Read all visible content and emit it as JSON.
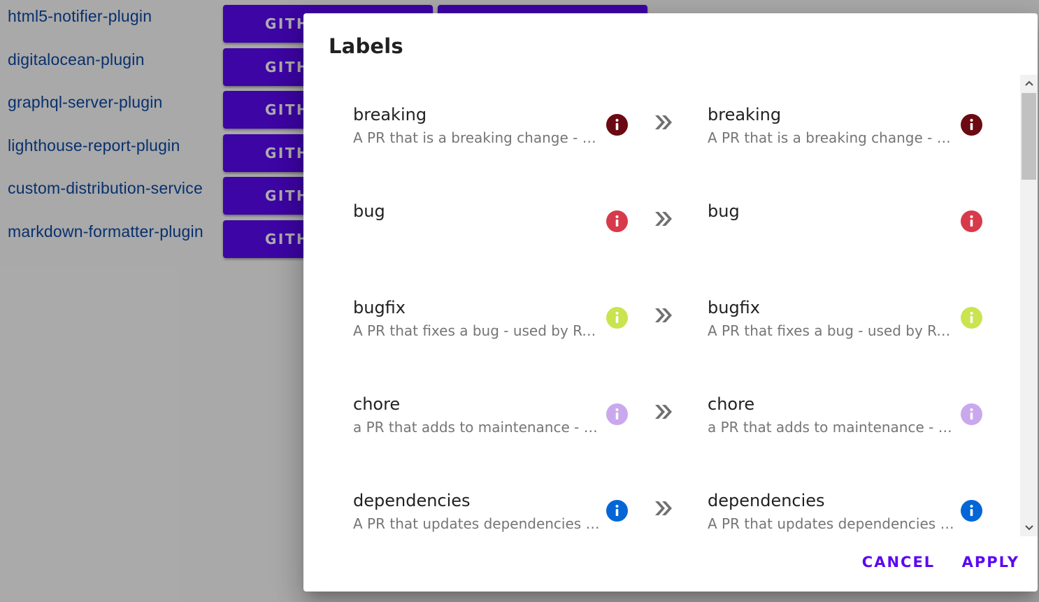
{
  "background": {
    "plugins": [
      {
        "name": "html5-notifier-plugin",
        "button": "GITH"
      },
      {
        "name": "digitalocean-plugin",
        "button": "GITH"
      },
      {
        "name": "graphql-server-plugin",
        "button": "GITH"
      },
      {
        "name": "lighthouse-report-plugin",
        "button": "GITH"
      },
      {
        "name": "custom-distribution-service",
        "button": "GITH"
      },
      {
        "name": "markdown-formatter-plugin",
        "button": "GITH"
      }
    ]
  },
  "dialog": {
    "title": "Labels",
    "cancel_label": "CANCEL",
    "apply_label": "APPLY",
    "labels": [
      {
        "left": {
          "name": "breaking",
          "description": "A PR that is a breaking change - used by Release Drafter"
        },
        "right": {
          "name": "breaking",
          "description": "A PR that is a breaking change - used by Release Drafter"
        },
        "color": "#6b0a12",
        "icon": "info-icon"
      },
      {
        "left": {
          "name": "bug",
          "description": ""
        },
        "right": {
          "name": "bug",
          "description": ""
        },
        "color": "#d73a4a",
        "icon": "info-icon"
      },
      {
        "left": {
          "name": "bugfix",
          "description": "A PR that fixes a bug - used by Release Drafter"
        },
        "right": {
          "name": "bugfix",
          "description": "A PR that fixes a bug - used by Release Drafter"
        },
        "color": "#c9e44f",
        "icon": "info-icon"
      },
      {
        "left": {
          "name": "chore",
          "description": "a PR that adds to maintenance - used by Release Drafter"
        },
        "right": {
          "name": "chore",
          "description": "a PR that adds to maintenance - used by Release Drafter"
        },
        "color": "#c9a8ed",
        "icon": "info-icon"
      },
      {
        "left": {
          "name": "dependencies",
          "description": "A PR that updates dependencies - used by Release Drafter"
        },
        "right": {
          "name": "dependencies",
          "description": "A PR that updates dependencies - used by Release Drafter"
        },
        "color": "#0466d6",
        "icon": "info-icon"
      }
    ],
    "arrow_icon": "double-chevron-right-icon",
    "scrollbar": {
      "up_icon": "chevron-up-icon",
      "down_icon": "chevron-down-icon"
    }
  },
  "colors": {
    "accent": "#5b08f2",
    "link": "#0d47a1",
    "scrim": "rgba(0,0,0,0.32)"
  }
}
